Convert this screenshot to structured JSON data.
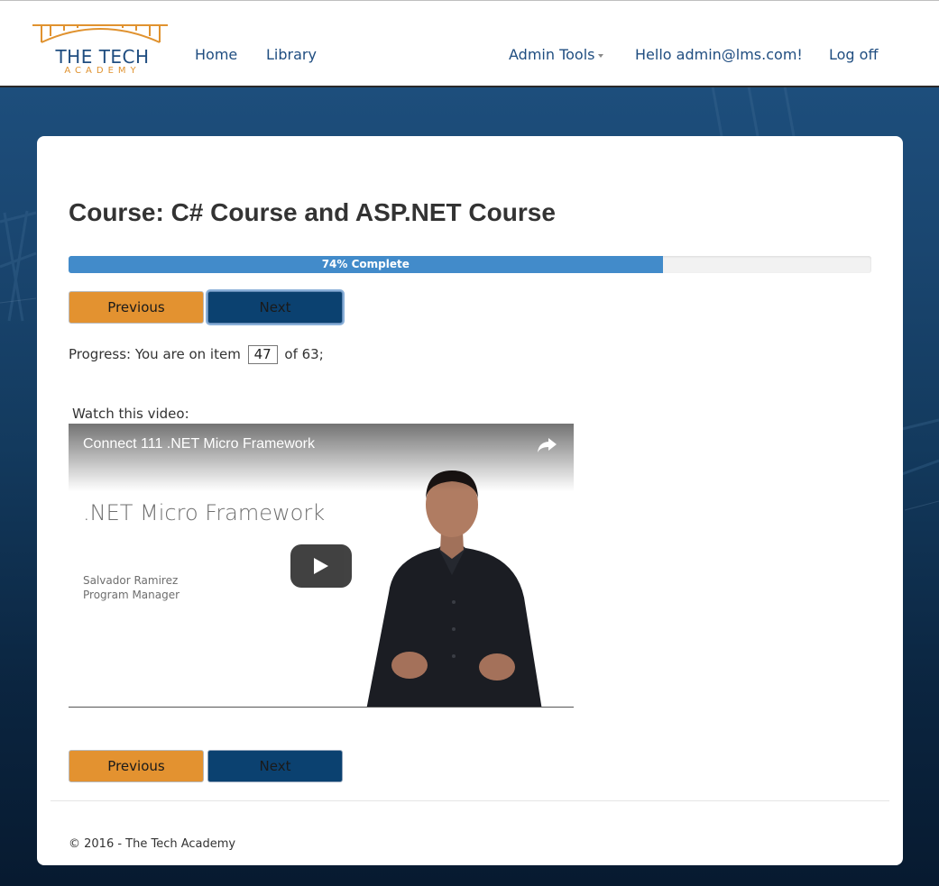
{
  "brand": {
    "title": "THE TECH",
    "subtitle": "ACADEMY",
    "colors": {
      "primary": "#1f4d80",
      "accent": "#e0922f"
    }
  },
  "nav": {
    "home": "Home",
    "library": "Library",
    "admin_tools": "Admin Tools",
    "greeting": "Hello admin@lms.com!",
    "logoff": "Log off"
  },
  "course": {
    "title": "Course: C# Course and ASP.NET Course",
    "percent_complete": 74,
    "progress_label": "74% Complete",
    "progress_prefix": "Progress: You are on item",
    "current_item": "47",
    "progress_suffix": "of 63;"
  },
  "buttons": {
    "previous": "Previous",
    "next": "Next",
    "colors": {
      "previous": "#e39230",
      "next": "#0b4170"
    }
  },
  "video": {
    "label": "Watch this video:",
    "title": "Connect 111 .NET Micro Framework",
    "slide_heading": ".NET Micro Framework",
    "presenter_name": "Salvador Ramirez",
    "presenter_role": "Program Manager",
    "icons": {
      "share": "share-icon",
      "play": "play-icon"
    }
  },
  "footer": {
    "copyright": "© 2016 - The Tech Academy"
  }
}
